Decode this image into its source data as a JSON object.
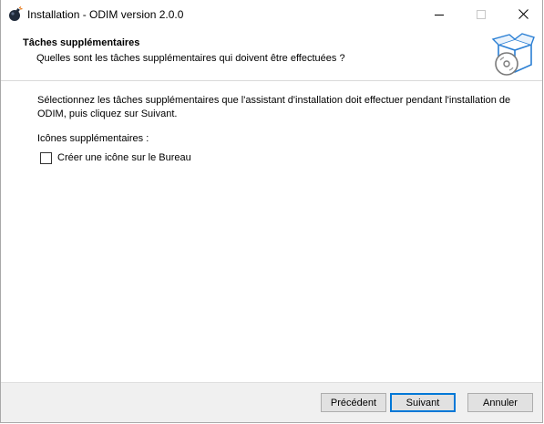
{
  "window": {
    "title": "Installation - ODIM version 2.0.0",
    "app_icon": "bomb-icon",
    "controls": {
      "minimize_icon": "minimize-icon",
      "maximize_icon": "maximize-icon",
      "close_icon": "close-icon"
    }
  },
  "header": {
    "title": "Tâches supplémentaires",
    "subtitle": "Quelles sont les tâches supplémentaires qui doivent être effectuées ?",
    "image_icon": "install-box-disc-icon"
  },
  "body": {
    "description": "Sélectionnez les tâches supplémentaires que l'assistant d'installation doit effectuer pendant l'installation de ODIM, puis cliquez sur Suivant.",
    "group_label": "Icônes supplémentaires :",
    "tasks": [
      {
        "label": "Créer une icône sur le Bureau",
        "checked": false
      }
    ]
  },
  "footer": {
    "back_label": "Précédent",
    "next_label": "Suivant",
    "cancel_label": "Annuler"
  },
  "colors": {
    "footer_bg": "#f0f0f0",
    "button_bg": "#e1e1e1",
    "focus_border": "#0078d7"
  }
}
